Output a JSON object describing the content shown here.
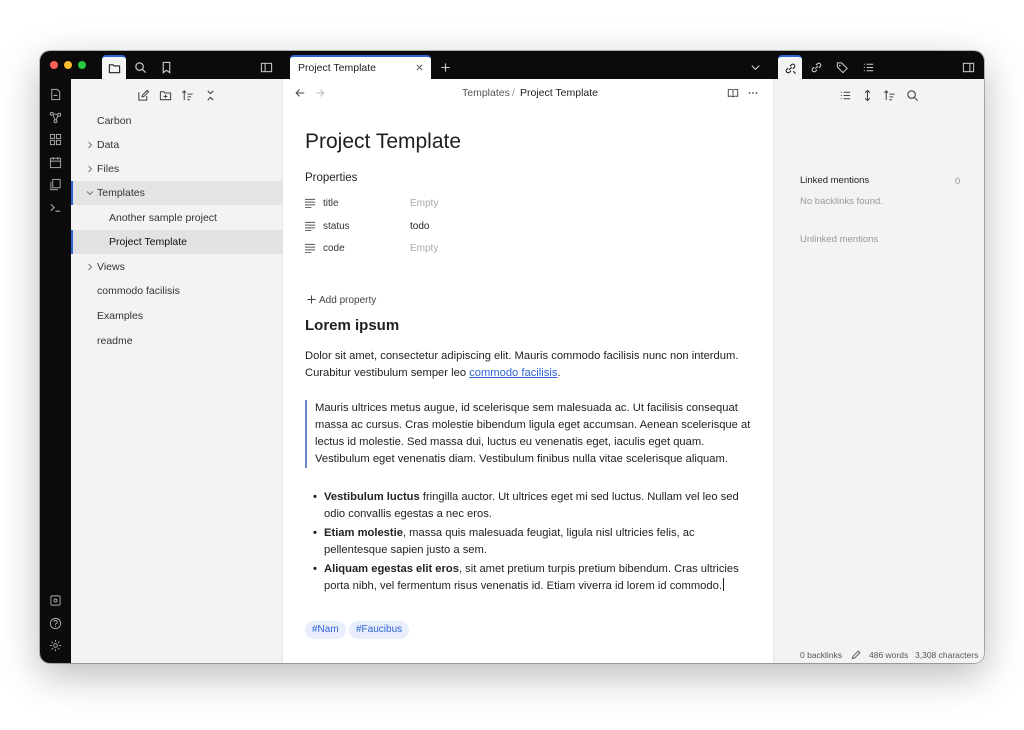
{
  "colors": {
    "accent": "#2f63d6",
    "titlebar": "#0b0b0b",
    "sidebar": "#f3f3f3",
    "tag_bg": "#e8eefb"
  },
  "tab": {
    "title": "Project Template"
  },
  "breadcrumb": {
    "parent": "Templates",
    "separator": "/",
    "current": "Project Template"
  },
  "sidebar": {
    "items": [
      {
        "label": "Carbon"
      },
      {
        "label": "Data"
      },
      {
        "label": "Files"
      },
      {
        "label": "Templates"
      },
      {
        "label": "Another sample project"
      },
      {
        "label": "Project Template"
      },
      {
        "label": "Views"
      },
      {
        "label": "commodo facilisis"
      },
      {
        "label": "Examples"
      },
      {
        "label": "readme"
      }
    ]
  },
  "note": {
    "title": "Project Template",
    "properties_heading": "Properties",
    "properties": [
      {
        "key": "title",
        "value": "Empty"
      },
      {
        "key": "status",
        "value": "todo"
      },
      {
        "key": "code",
        "value": "Empty"
      }
    ],
    "add_property": "Add property",
    "heading": "Lorem ipsum",
    "para_text": "Dolor sit amet, consectetur adipiscing elit. Mauris commodo facilisis nunc non interdum. Curabitur vestibulum semper leo ",
    "para_link": "commodo facilisis",
    "para_end": ".",
    "quote": "Mauris ultrices metus augue, id scelerisque sem malesuada ac. Ut facilisis consequat massa ac cursus. Cras molestie bibendum ligula eget accumsan. Aenean scelerisque at lectus id molestie. Sed massa dui, luctus eu venenatis eget, iaculis eget quam. Vestibulum eget venenatis diam. Vestibulum finibus nulla vitae scelerisque aliquam.",
    "bullets": [
      {
        "bold": "Vestibulum luctus",
        "text": " fringilla auctor. Ut ultrices eget mi sed luctus. Nullam vel leo sed odio convallis egestas a nec eros."
      },
      {
        "bold": "Etiam molestie",
        "text": ", massa quis malesuada feugiat, ligula nisl ultricies felis, ac pellentesque sapien justo a sem."
      },
      {
        "bold": "Aliquam egestas elit eros",
        "text": ", sit amet pretium turpis pretium bibendum. Cras ultricies porta nibh, vel fermentum risus venenatis id. Etiam viverra id lorem id commodo."
      }
    ],
    "tags": [
      "#Nam",
      "#Faucibus"
    ]
  },
  "backlinks": {
    "linked_label": "Linked mentions",
    "linked_count": "0",
    "empty_text": "No backlinks found.",
    "unlinked_label": "Unlinked mentions"
  },
  "statusbar": {
    "backlinks": "0 backlinks",
    "words": "486 words",
    "characters": "3,308 characters"
  },
  "icons": {
    "titlebar": [
      "folder-icon",
      "search-icon",
      "bookmark-icon",
      "sidebar-toggle-icon",
      "plus-icon",
      "chevron-down-icon",
      "backlinks-icon",
      "outgoing-links-icon",
      "tags-icon",
      "outline-icon",
      "right-sidebar-toggle-icon"
    ],
    "ribbon": [
      "open-daily-note-icon",
      "graph-icon",
      "canvas-icon",
      "calendar-icon",
      "templates-icon",
      "command-palette-icon",
      "vault-icon",
      "help-icon",
      "settings-icon"
    ]
  }
}
